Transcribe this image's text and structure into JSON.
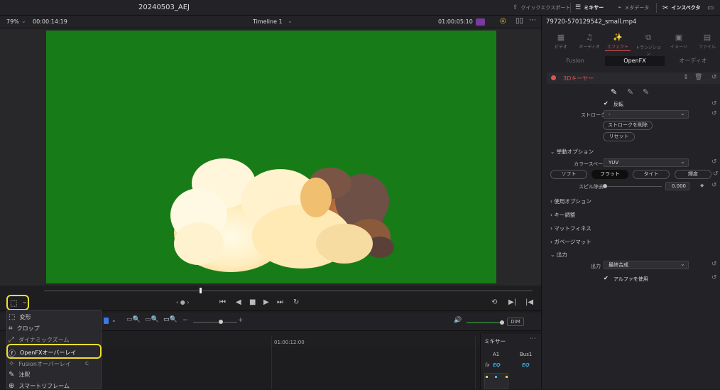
{
  "topbar": {
    "project_title": "20240503_AEJ",
    "quick_export": "クイックエクスポート",
    "mixer": "ミキサー",
    "metadata": "メタデータ",
    "inspector": "インスペクタ"
  },
  "viewer": {
    "zoom": "79%",
    "timecode_left": "00:00:14:19",
    "timeline_name": "Timeline 1",
    "timecode_right": "01:00:05:10"
  },
  "inspector": {
    "clip_name": "79720-570129542_small.mp4",
    "tabs": [
      {
        "label": "ビデオ",
        "icon": "video-icon"
      },
      {
        "label": "オーディオ",
        "icon": "audio-icon"
      },
      {
        "label": "エフェクト",
        "icon": "effects-wand-icon"
      },
      {
        "label": "トランジション",
        "icon": "transition-icon"
      },
      {
        "label": "イメージ",
        "icon": "image-icon"
      },
      {
        "label": "ファイル",
        "icon": "file-icon"
      }
    ],
    "subtabs": [
      "Fusion",
      "OpenFX",
      "オーディオ"
    ],
    "effect_name": "3Dキーヤー",
    "invert_label": "反転",
    "stroke_label": "ストローク",
    "stroke_value": "-",
    "delete_stroke": "ストロークを削除",
    "reset": "リセット",
    "behavior_section": "挙動オプション",
    "colorspace_label": "カラースペース",
    "colorspace_value": "YUV",
    "softness_options": [
      "ソフト",
      "フラット",
      "タイト",
      "輝度"
    ],
    "spill_label": "スピル除去",
    "spill_value": "0.000",
    "sections": [
      "使用オプション",
      "キー調整",
      "マットフィネス",
      "ガベージマット"
    ],
    "output_section": "出力",
    "output_label": "出力",
    "output_value": "最終合成",
    "use_alpha": "アルファを使用"
  },
  "menu": {
    "items": [
      "変形",
      "クロップ",
      "ダイナミックズーム",
      "OpenFXオーバーレイ",
      "Fusionオーバーレイ",
      "注釈",
      "スマートリフレーム"
    ],
    "fusion_shortcut": "C"
  },
  "timeline": {
    "ruler_time": "01:00:12:00",
    "dim": "DIM"
  },
  "mixer": {
    "title": "ミキサー",
    "a1": "A1",
    "bus1": "Bus1",
    "fx": "fx",
    "eq": "EQ"
  },
  "colors": {
    "accent": "#e05252",
    "highlight": "#f0e030",
    "screen_green": "#177c17"
  }
}
